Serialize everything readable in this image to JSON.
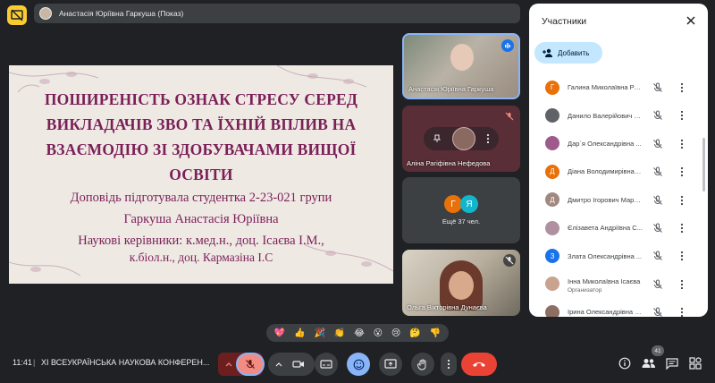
{
  "presenter": {
    "label": "Анастасія Юріївна Гаркуша (Показ)"
  },
  "slide": {
    "title_lines": [
      "ПОШИРЕНІСТЬ ОЗНАК СТРЕСУ СЕРЕД",
      "ВИКЛАДАЧІВ ЗВО ТА ЇХНІЙ ВПЛИВ НА",
      "ВЗАЄМОДІЮ ЗІ ЗДОБУВАЧАМИ ВИЩОЇ",
      "ОСВІТИ"
    ],
    "author_line": "Доповідь підготувала студентка 2-23-021 групи",
    "author_name": "Гаркуша Анастасія Юріївна",
    "supervisors_1": "Наукові керівники: к.мед.н., доц. Ісаєва І.М.,",
    "supervisors_2": "к.біол.н., доц. Кармазіна І.С"
  },
  "tiles": [
    {
      "name": "Анастасія Юріївна Гаркуша"
    },
    {
      "name": "Аліна Рагіфівна Нефедова"
    },
    {
      "more_label": "Ещё 37 чел.",
      "initials": [
        "Г",
        "Я"
      ]
    },
    {
      "name": "Ольга Вікторівна Дунаєва"
    }
  ],
  "panel": {
    "title": "Участники",
    "add_label": "Добавить",
    "participants": [
      {
        "initial": "Г",
        "name": "Галина Миколаївна Ра...",
        "color": "#e8710a",
        "role": ""
      },
      {
        "initial": "",
        "name": "Данило Валерійович М...",
        "color": "#5f6368",
        "role": ""
      },
      {
        "initial": "",
        "name": "Дар`я Олександрівна ...",
        "color": "#9e5a8a",
        "role": ""
      },
      {
        "initial": "Д",
        "name": "Діана Володимирівна Г...",
        "color": "#e8710a",
        "role": ""
      },
      {
        "initial": "Д",
        "name": "Дмитро Ігорович Мара...",
        "color": "#a1887f",
        "role": ""
      },
      {
        "initial": "",
        "name": "Єлізавета Андріївна С...",
        "color": "#b08fa0",
        "role": ""
      },
      {
        "initial": "З",
        "name": "Злата Олександрівна ...",
        "color": "#1a73e8",
        "role": ""
      },
      {
        "initial": "",
        "name": "Інна Миколаївна Ісаєва",
        "color": "#c9a38f",
        "role": "Организатор"
      },
      {
        "initial": "",
        "name": "Ірина Олександрівна Б...",
        "color": "#8d6e63",
        "role": ""
      }
    ]
  },
  "reactions": [
    "💖",
    "👍",
    "🎉",
    "👏",
    "😂",
    "😮",
    "😢",
    "🤔",
    "👎"
  ],
  "bottom": {
    "time": "11:41",
    "separator": "|",
    "meeting_title": "ХІ ВСЕУКРАЇНСЬКА НАУКОВА КОНФЕРЕН...",
    "participants_count": "41"
  }
}
